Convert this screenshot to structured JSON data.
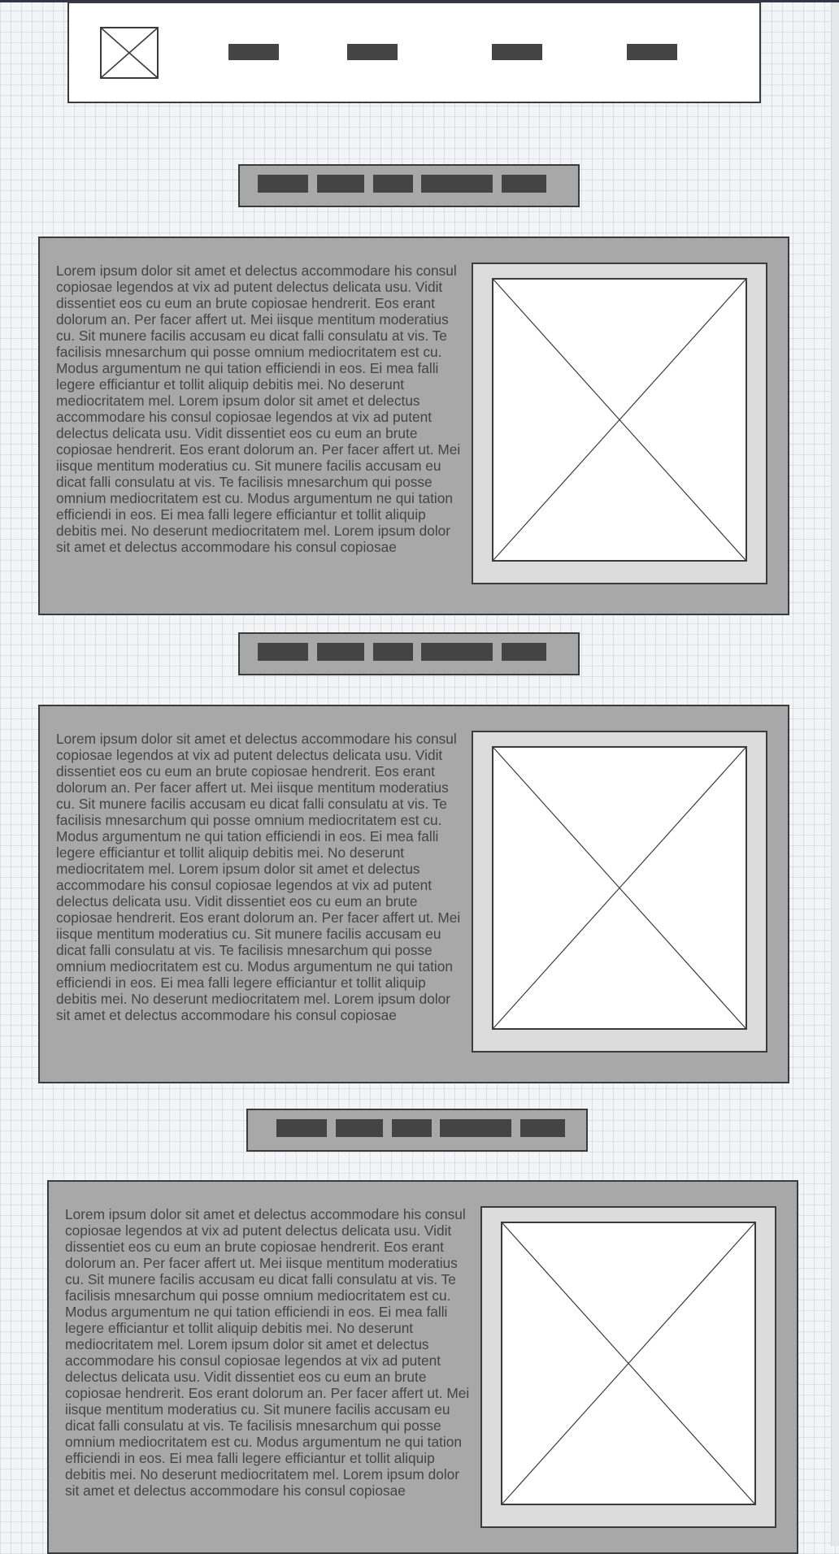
{
  "header": {
    "logo": {
      "icon": "image-placeholder-icon"
    },
    "nav_items": [
      "",
      "",
      "",
      ""
    ]
  },
  "sections": [
    {
      "body": "Lorem ipsum dolor sit amet et delectus accommodare his consul copiosae legendos at vix ad putent delectus delicata usu. Vidit dissentiet eos cu eum an brute copiosae hendrerit. Eos erant dolorum an. Per facer affert ut. Mei iisque mentitum moderatius cu. Sit munere facilis accusam eu dicat falli consulatu at vis. Te facilisis mnesarchum qui posse omnium mediocritatem est cu. Modus argumentum ne qui tation efficiendi in eos. Ei mea falli legere efficiantur et tollit aliquip debitis mei. No deserunt mediocritatem mel. Lorem ipsum dolor sit amet et delectus accommodare his consul copiosae legendos at vix ad putent delectus delicata usu. Vidit dissentiet eos cu eum an brute copiosae hendrerit. Eos erant dolorum an. Per facer affert ut. Mei iisque mentitum moderatius cu. Sit munere facilis accusam eu dicat falli consulatu at vis. Te facilisis mnesarchum qui posse omnium mediocritatem est cu. Modus argumentum ne qui tation efficiendi in eos. Ei mea falli legere efficiantur et tollit aliquip debitis mei. No deserunt mediocritatem mel. Lorem ipsum dolor sit amet et delectus accommodare his consul copiosae",
      "image": "image-placeholder-icon"
    },
    {
      "body": "Lorem ipsum dolor sit amet et delectus accommodare his consul copiosae legendos at vix ad putent delectus delicata usu. Vidit dissentiet eos cu eum an brute copiosae hendrerit. Eos erant dolorum an. Per facer affert ut. Mei iisque mentitum moderatius cu. Sit munere facilis accusam eu dicat falli consulatu at vis. Te facilisis mnesarchum qui posse omnium mediocritatem est cu. Modus argumentum ne qui tation efficiendi in eos. Ei mea falli legere efficiantur et tollit aliquip debitis mei. No deserunt mediocritatem mel. Lorem ipsum dolor sit amet et delectus accommodare his consul copiosae legendos at vix ad putent delectus delicata usu. Vidit dissentiet eos cu eum an brute copiosae hendrerit. Eos erant dolorum an. Per facer affert ut. Mei iisque mentitum moderatius cu. Sit munere facilis accusam eu dicat falli consulatu at vis. Te facilisis mnesarchum qui posse omnium mediocritatem est cu. Modus argumentum ne qui tation efficiendi in eos. Ei mea falli legere efficiantur et tollit aliquip debitis mei. No deserunt mediocritatem mel. Lorem ipsum dolor sit amet et delectus accommodare his consul copiosae",
      "image": "image-placeholder-icon"
    },
    {
      "body": "Lorem ipsum dolor sit amet et delectus accommodare his consul copiosae legendos at vix ad putent delectus delicata usu. Vidit dissentiet eos cu eum an brute copiosae hendrerit. Eos erant dolorum an. Per facer affert ut. Mei iisque mentitum moderatius cu. Sit munere facilis accusam eu dicat falli consulatu at vis. Te facilisis mnesarchum qui posse omnium mediocritatem est cu. Modus argumentum ne qui tation efficiendi in eos. Ei mea falli legere efficiantur et tollit aliquip debitis mei. No deserunt mediocritatem mel. Lorem ipsum dolor sit amet et delectus accommodare his consul copiosae legendos at vix ad putent delectus delicata usu. Vidit dissentiet eos cu eum an brute copiosae hendrerit. Eos erant dolorum an. Per facer affert ut. Mei iisque mentitum moderatius cu. Sit munere facilis accusam eu dicat falli consulatu at vis. Te facilisis mnesarchum qui posse omnium mediocritatem est cu. Modus argumentum ne qui tation efficiendi in eos. Ei mea falli legere efficiantur et tollit aliquip debitis mei. No deserunt mediocritatem mel. Lorem ipsum dolor sit amet et delectus accommodare his consul copiosae",
      "image": "image-placeholder-icon"
    }
  ],
  "subnav": {
    "pills": [
      "",
      "",
      "",
      "",
      ""
    ]
  },
  "colors": {
    "canvas": "#f3f4f6",
    "panel": "#a8a8a8",
    "frame": "#dcdcdc",
    "block": "#444444",
    "stroke": "#3b3b3b",
    "text": "#444444"
  }
}
